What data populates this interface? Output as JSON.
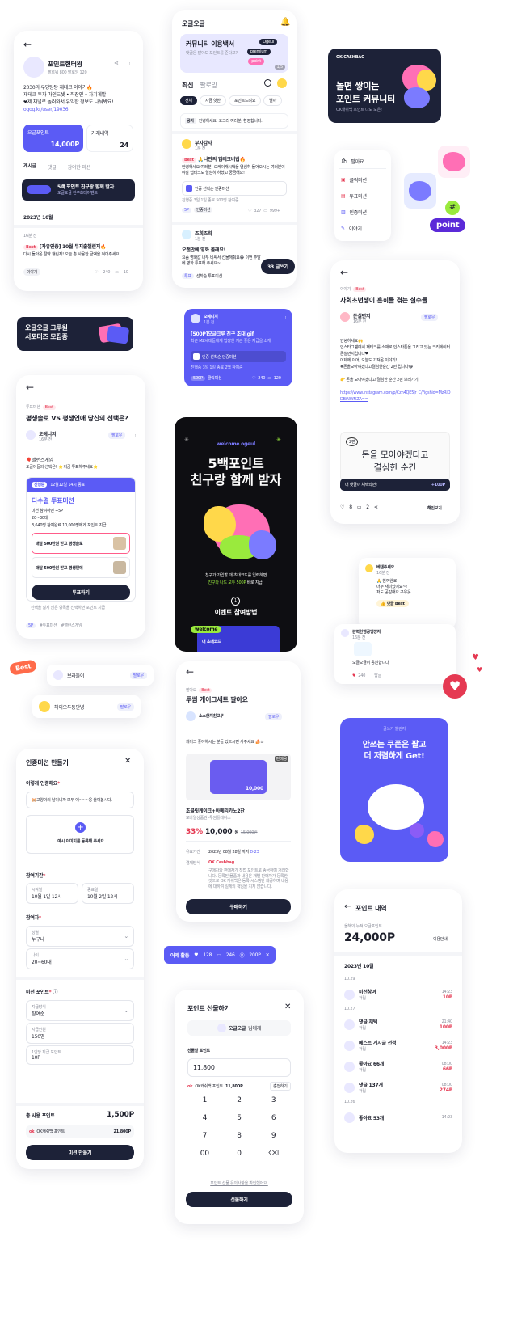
{
  "profile": {
    "name": "포인트헌터왕",
    "stats": "팔로워 800  팔로잉 120",
    "bio1": "2030의 우당탕탕 재테크 이야기🔥",
    "bio2": "재테크 투자 마인드셋 • 직장인 • 자기계발",
    "bio3": "❤제 채널로 놀러와서 유익한 정보도 나눠봐요!",
    "link": "ogog.kr/user/19036",
    "point_label": "오글포인트",
    "point_value": "14,000P",
    "history_label": "거래내역",
    "history_value": "24",
    "tabs": [
      "게시글",
      "댓글",
      "참여한 미션"
    ],
    "banner_title": "5백 포인트 친구랑 함께 받자",
    "banner_sub": "오글오글 친구초대이벤트",
    "month": "2023년 10월",
    "post_time": "16분 전",
    "post_title": "[자유인증] 10월 무지출챌린지🔥",
    "post_body": "다시 돌아온 절약 챌린지! 오늘 총 사용한 금액을 적어주세요",
    "tag": "이야기",
    "likes": "240",
    "comments": "10"
  },
  "community": {
    "title": "오글오글",
    "banner_title": "커뮤니티 이용백서",
    "banner_sub": "댓글은 달아도 포인트를 준다고?",
    "banner_tags": [
      "Ogeul",
      "premium",
      "point"
    ],
    "banner_page": "1/5",
    "tabs": [
      "최신",
      "팔로잉"
    ],
    "chips": [
      "전체",
      "지금 핫한",
      "포인트드려요",
      "빨아"
    ],
    "notice_tag": "공지",
    "notice": "안녕하세요. 오그리 여러분, 환영합니다.",
    "post1_user": "부자감자",
    "post1_time": "1분 전",
    "post1_title": "🙏나만의 앱테크비법🔥",
    "post1_body": "안녕하세요 여러분! 오케이캐시백을 열심히 들어오시는 여러분이야말 앱테크도 열심히 하셨고 궁금해요!",
    "post1_mission": "인증  선착순 인증미션",
    "post1_meta": "진행중 3일 1일 종료   500명 참여중",
    "post1_point": "5P",
    "post1_tag": "인증미션",
    "post1_likes": "327",
    "post1_comments": "999+",
    "post2_user": "조회조회",
    "post2_time": "1분 전",
    "post2_title": "오랜만에 영화 볼래요!",
    "post2_body": "요즘 영화값 너무 비싸서 선물해줘요😂 이번 주말에 영화 투표해 주세요~",
    "post2_tag": "투표",
    "post2_tag2": "선착순 투표미션",
    "write_button": "33 글쓰기"
  },
  "promo": {
    "brand": "OK CASHBAG",
    "title1": "놀면 쌓이는",
    "title2": "포인트 커뮤니티",
    "sub": "OK캐쉬백 포인트 나도 모은!"
  },
  "menu": {
    "items": [
      "팔아요",
      "클릭미션",
      "투표미션",
      "인증미션",
      "이야기"
    ],
    "point_sticker": "point"
  },
  "post_detail": {
    "category": "이야기",
    "title": "사회초년생이 흔히들 겪는 실수들",
    "user": "돈실면지",
    "time": "16분 전",
    "follow": "팔로우",
    "body1": "안녕하세요🙌",
    "body2": "인스타그램에서 재테크를 소재로 인스타툰을 그리고 있는 크리에이터 돈실면지입니다❤",
    "body3": "어제에 이어, 오늘도 가져온 이야기!",
    "body4": "#돈을모아야겠다고결심한순간 2편 입니다😂",
    "body5": "👉 돈을 모아야겠다고 결심한 순간 2편 보러가기",
    "url": "https://www.instagram.com/p/Czh4QE5Jr_C/?igshid=MzRlODBiNWFlZA==",
    "comic_text1": "2편",
    "comic_text2": "돈을 모아야겠다고",
    "comic_text3": "결심한 순간",
    "comment_prompt": "내 댓글이 채택되면!",
    "comment_reward": "+100P",
    "likes": "8",
    "comments": "2",
    "more": "해인보기"
  },
  "supporter": {
    "line1": "오글오글 크루원",
    "line2": "서포터즈 모집중"
  },
  "vote_card": {
    "category": "투표미션",
    "title": "평생솔로 VS 평생연애 당신의 선택은?",
    "user": "오예니저",
    "time": "16분 전",
    "follow": "팔로우",
    "game": "🎈밸런스게임",
    "game_sub": "오글이들의 선택은? ⭐지금 투표해주세요⭐",
    "status": "진행중",
    "status_date": "12월12일 14시 종료",
    "mission_title": "다수결 투표미션",
    "mission_sub": "미션 참여하면 +5P",
    "age": "20~30대",
    "count": "3,640명 참여완료   10,000명에게 포인트 지급",
    "opt1": "매달 500만원 받고 평생솔로",
    "opt2": "매달 500만원 받고 평생연애",
    "button": "투표하기",
    "note": "선택을 않지 않은 항목을 선택하면 포인트 지급",
    "point": "5P",
    "tags": [
      "#투표미션",
      "#밸런스게임"
    ]
  },
  "blue_post": {
    "user": "오예니저",
    "time": "1분 전",
    "title": "[500P]오글크루 친구 초대.gif",
    "body": "최근 MZ세대들에게 입장한 기근 좋은 지급을 소개",
    "mission": "인증  선착순 인증미션",
    "meta": "진행중 3일 1일 종료   2백 참여중",
    "point": "500P",
    "tag": "클릭미션",
    "likes": "240",
    "comments": "120"
  },
  "event": {
    "welcome": "welcome ogeul",
    "title1": "5백포인트",
    "title2": "친구랑 함께 받자",
    "desc1": "친구가 가입할 때 초대코드를 입력하면",
    "desc2_hl": "친구와 나도 모두 500P",
    "desc2": "바로 지급!",
    "step": "1",
    "how": "이벤트 참여방법",
    "sticker": "welcome",
    "code_label": "내 초대코드"
  },
  "comment": {
    "user1": "베댄주세요",
    "time1": "16분 전",
    "body1a": "🙏 참여완료",
    "body1b": "너무 재미있어요~!",
    "body1c": "저도 공감해요 구우웃",
    "best": "👍 댓글 Best",
    "user2": "감력한맹공맹장자",
    "time2": "16분 전",
    "body2": "오글오글이 응원합니다",
    "likes": "240",
    "reply": "답글"
  },
  "best_sticker": "Best",
  "follow_rows": [
    {
      "name": "보라돌이",
      "btn": "팔로우"
    },
    {
      "name": "헤이오두둥만녕",
      "btn": "팔로우"
    }
  ],
  "cake": {
    "category": "팔아요",
    "title": "투썸 케이크세트 팔아요",
    "user": "소소한지친고쿠",
    "follow": "팔로우",
    "desc": "케이크 좋아하시는 분들 있으시면 사주세요 🍰☕",
    "sold": "판매용",
    "voucher_value": "10,000",
    "product": "초콜릿케이크+아메리카노2잔",
    "product_sub": "모바일상품권•투썸플레이스",
    "discount": "33%",
    "price": "10,000",
    "won": "원",
    "orig": "15,000원",
    "period_label": "유효기간",
    "period": "2023년 08월 28일 까지",
    "dday": "D-23",
    "pay_label": "결제방식",
    "pay": "OK Cashbag",
    "notice": "구매자와 판매자가 직접 포인트로 송금하며 거래합니다. 등록된 물품과 내용은 개별 판매자가 등록한 것으로 OK 캐쉬백은 등록 시스템만 제공하며 내용에 대하여 일체의 책임을 지지 않습니다.",
    "button": "구매하기"
  },
  "challenge": {
    "label": "글쓰기 챌린지",
    "title1": "안쓰는 쿠폰은 팔고",
    "title2": "더 저렴하게 Get!"
  },
  "mission_create": {
    "title": "인증미션 만들기",
    "method_label": "이렇게 인증해요",
    "method_value": "🐹고양이의 날이니까 모두 애~~~옹 울어봅시다.",
    "upload": "예시 이미지를 등록해 주세요",
    "period_label": "참여기간",
    "start_label": "시작일",
    "start": "10월 1일 12시",
    "end_label": "종료일",
    "end": "10월 2일 12시",
    "target_label": "참여자",
    "gender_label": "성별",
    "gender": "누구나",
    "age_label": "나이",
    "age": "20~60대",
    "point_label": "미션 포인트",
    "type_label": "지급방식",
    "type": "참여순",
    "count_label": "지급인원",
    "count": "150명",
    "per_label": "1인당 지급 포인트",
    "per": "10P",
    "total_label": "총 사용 포인트",
    "total": "1,500P",
    "ok_label": "OK캐쉬백 포인트",
    "ok_value": "21,800P",
    "button": "미션 만들기"
  },
  "activity": {
    "label": "어제 활동",
    "likes": "128",
    "comments": "246",
    "points": "200P"
  },
  "gift": {
    "title": "포인트 선물하기",
    "to": "오글오글",
    "to_suffix": "님에게",
    "amount_label": "선물할 포인트",
    "amount": "11,800",
    "avail_prefix": "OK캐쉬백 포인트",
    "avail": "11,800P",
    "charge": "충전하기",
    "keys": [
      "1",
      "2",
      "3",
      "4",
      "5",
      "6",
      "7",
      "8",
      "9",
      "00",
      "0",
      "⌫"
    ],
    "terms": "포인트 선물 유의사항을 확인했어요.",
    "button": "선물하기"
  },
  "history": {
    "title": "포인트 내역",
    "sub": "올해의 누적 오글포인트",
    "total": "24,000P",
    "guide": "이용안내",
    "month": "2023년 10월",
    "items": [
      {
        "date": "10.29",
        "name": "미션참여",
        "type": "적립",
        "time": "14:23",
        "pts": "10P"
      },
      {
        "date": "10.27",
        "name": "댓글 채택",
        "type": "적립",
        "time": "21:40",
        "pts": "100P"
      },
      {
        "date": "",
        "name": "베스트 게시글 선정",
        "type": "적립",
        "time": "14:23",
        "pts": "3,000P"
      },
      {
        "date": "",
        "name": "좋아요 66개",
        "type": "적립",
        "time": "08:00",
        "pts": "66P"
      },
      {
        "date": "",
        "name": "댓글 137개",
        "type": "적립",
        "time": "08:00",
        "pts": "274P"
      },
      {
        "date": "10.26",
        "name": "좋아요 53개",
        "type": "",
        "time": "14:23",
        "pts": ""
      }
    ]
  },
  "colors": {
    "purple": "#5b5bf5",
    "navy": "#1d2238",
    "red": "#e53952",
    "pink": "#ff6fb5",
    "yellow": "#ffd84a",
    "green": "#9aea3d"
  }
}
